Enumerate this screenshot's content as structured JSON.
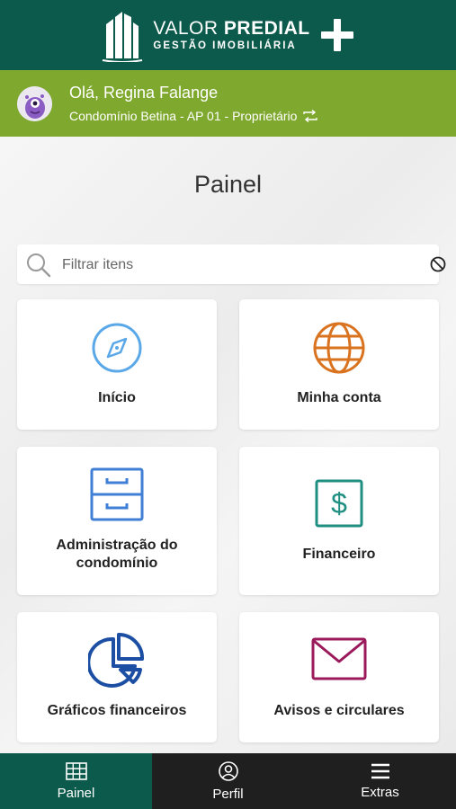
{
  "header": {
    "brand_line1_light": "VALOR",
    "brand_line1_bold": "PREDIAL",
    "brand_line2": "GESTÃO IMOBILIÁRIA"
  },
  "user": {
    "greeting": "Olá, Regina Falange",
    "condo": "Condomínio Betina - AP 01 - Proprietário"
  },
  "page": {
    "title": "Painel"
  },
  "search": {
    "placeholder": "Filtrar itens",
    "value": ""
  },
  "cards": [
    {
      "label": "Início",
      "icon": "compass-icon",
      "color": "#5aa8e8"
    },
    {
      "label": "Minha conta",
      "icon": "globe-icon",
      "color": "#d9731f"
    },
    {
      "label": "Administração do condomínio",
      "icon": "cabinet-icon",
      "color": "#3f7fd6"
    },
    {
      "label": "Financeiro",
      "icon": "dollar-icon",
      "color": "#1f8f82"
    },
    {
      "label": "Gráficos financeiros",
      "icon": "pie-chart-icon",
      "color": "#1c4fa3"
    },
    {
      "label": "Avisos e circulares",
      "icon": "envelope-icon",
      "color": "#9b1a5c"
    }
  ],
  "nav": [
    {
      "label": "Painel",
      "icon": "grid-icon",
      "active": true
    },
    {
      "label": "Perfil",
      "icon": "user-icon",
      "active": false
    },
    {
      "label": "Extras",
      "icon": "menu-icon",
      "active": false
    }
  ],
  "colors": {
    "header": "#0c5a4c",
    "user_bar": "#7fa82e",
    "nav_bg": "#1f1f1f"
  }
}
